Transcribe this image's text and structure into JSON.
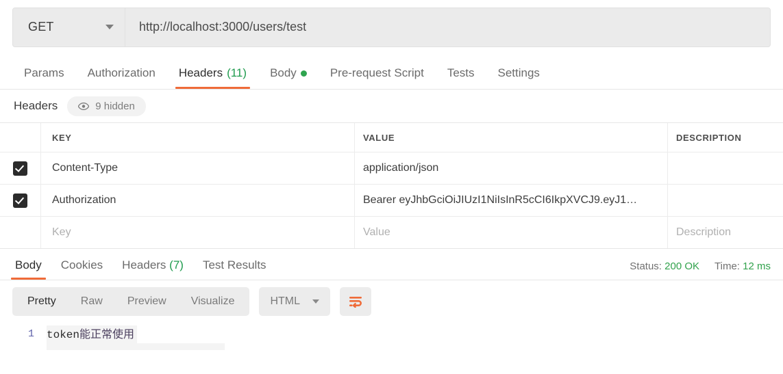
{
  "request_bar": {
    "method": "GET",
    "method_icon": "chevron-down-icon",
    "url": "http://localhost:3000/users/test",
    "url_placeholder": "Enter request URL"
  },
  "request_tabs": [
    {
      "label": "Params",
      "count": "",
      "active": false,
      "dot": false
    },
    {
      "label": "Authorization",
      "count": "",
      "active": false,
      "dot": false
    },
    {
      "label": "Headers",
      "count": "(11)",
      "active": true,
      "dot": false
    },
    {
      "label": "Body",
      "count": "",
      "active": false,
      "dot": true
    },
    {
      "label": "Pre-request Script",
      "count": "",
      "active": false,
      "dot": false
    },
    {
      "label": "Tests",
      "count": "",
      "active": false,
      "dot": false
    },
    {
      "label": "Settings",
      "count": "",
      "active": false,
      "dot": false
    }
  ],
  "headers_section": {
    "title": "Headers",
    "hidden_pill_label": "9 hidden",
    "hidden_pill_icon": "eye-icon",
    "columns": [
      "KEY",
      "VALUE",
      "DESCRIPTION"
    ],
    "rows": [
      {
        "checked": true,
        "key": "Content-Type",
        "value": "application/json",
        "description": ""
      },
      {
        "checked": true,
        "key": "Authorization",
        "value": "Bearer eyJhbGciOiJIUzI1NiIsInR5cCI6IkpXVCJ9.eyJ1…",
        "description": ""
      }
    ],
    "empty_row": {
      "key_placeholder": "Key",
      "value_placeholder": "Value",
      "description_placeholder": "Description"
    }
  },
  "response_tabs": [
    {
      "label": "Body",
      "count": "",
      "active": true
    },
    {
      "label": "Cookies",
      "count": "",
      "active": false
    },
    {
      "label": "Headers",
      "count": "(7)",
      "active": false
    },
    {
      "label": "Test Results",
      "count": "",
      "active": false
    }
  ],
  "response_meta": {
    "status_label": "Status:",
    "status_value": "200 OK",
    "time_label": "Time:",
    "time_value": "12 ms"
  },
  "response_toolbar": {
    "views": [
      {
        "label": "Pretty",
        "active": true
      },
      {
        "label": "Raw",
        "active": false
      },
      {
        "label": "Preview",
        "active": false
      },
      {
        "label": "Visualize",
        "active": false
      }
    ],
    "language": "HTML",
    "language_icon": "chevron-down-icon",
    "wrap_icon": "word-wrap-icon"
  },
  "response_body": {
    "lines": [
      {
        "number": "1",
        "ascii": "token",
        "cjk": "能正常使用"
      }
    ]
  },
  "colors": {
    "accent": "#ef6b38",
    "success": "#31a24c",
    "count_green": "#1f9b4e",
    "panel": "#ececec",
    "field": "#ebebeb"
  }
}
